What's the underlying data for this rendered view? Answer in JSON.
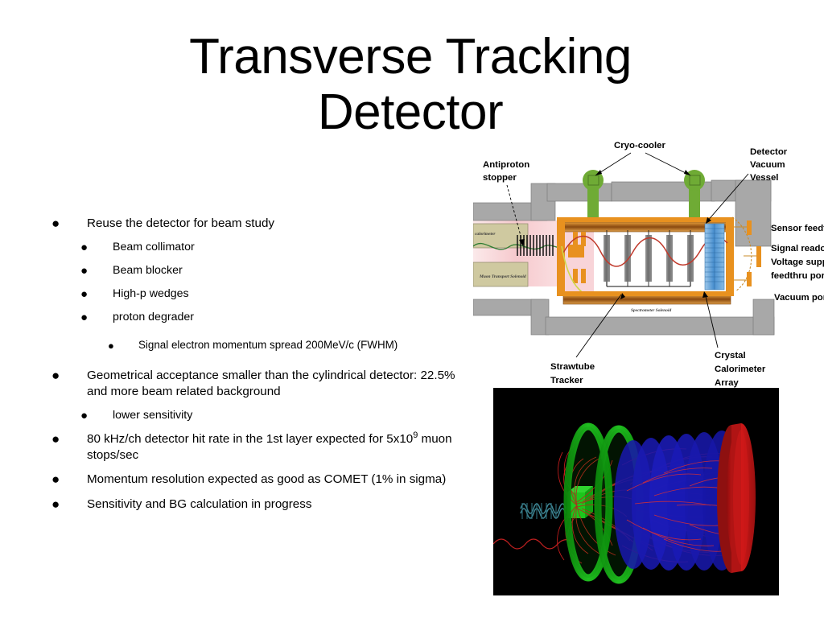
{
  "slide": {
    "title": "Transverse Tracking\nDetector"
  },
  "body": {
    "bullets": [
      {
        "level": 1,
        "text": "Reuse the detector for beam study"
      },
      {
        "level": 2,
        "text": "Beam collimator"
      },
      {
        "level": 2,
        "text": "Beam blocker"
      },
      {
        "level": 2,
        "text": "High-p wedges"
      },
      {
        "level": 2,
        "text": "proton degrader"
      },
      {
        "level": 3,
        "text": "Signal electron momentum spread 200MeV/c (FWHM)"
      },
      {
        "level": 1,
        "text": "Geometrical acceptance smaller than the cylindrical detector: 22.5% and more beam related background"
      },
      {
        "level": 2,
        "text": "lower sensitivity"
      },
      {
        "level": 1,
        "text": "80 kHz/ch detector hit rate in the 1st layer expected for 5x10⁹ muon stops/sec"
      },
      {
        "level": 1,
        "text": "Momentum resolution expected as good as COMET (1% in sigma)"
      },
      {
        "level": 1,
        "text": "Sensitivity and BG calculation in progress"
      }
    ]
  },
  "diagram": {
    "labels": {
      "cryo_cooler": "Cryo-cooler",
      "antiproton_stopper": "Antiproton stopper",
      "antiproton_stopper_line1": "Antiproton",
      "antiproton_stopper_line2": "stopper",
      "detector_vacuum_vessel_line1": "Detector",
      "detector_vacuum_vessel_line2": "Vacuum",
      "detector_vacuum_vessel_line3": "Vessel",
      "sensor_feedthru": "Sensor feedthru",
      "signal_readout_line1": "Signal readout &",
      "signal_readout_line2": "Voltage supply",
      "signal_readout_line3": "feedthru port",
      "vacuum_port": "Vacuum port",
      "strawtube_tracker_line1": "Strawtube",
      "strawtube_tracker_line2": "Tracker",
      "crystal_calorimeter_line1": "Crystal",
      "crystal_calorimeter_line2": "Calorimeter",
      "crystal_calorimeter_line3": "Array",
      "calorimeter_inline": "calorimeter",
      "muon_transport_solenoid": "Muon Transport Solenoid",
      "spectrometer_solenoid": "Spectrometer Solenoid"
    },
    "colors": {
      "steel_gray": "#a8a8a8",
      "steel_gray_dark": "#8e8e8e",
      "cryo_green": "#6fab35",
      "flange_orange": "#e8911f",
      "coil_orange": "#c9741a",
      "crystal_blue": "#5b9bd5",
      "track_red": "#c0392b",
      "beam_pink": "#f7cfd2",
      "khaki": "#cfc9a0"
    }
  },
  "simulation": {
    "colors": {
      "background": "#000000",
      "tracker_ring_green": "#14a014",
      "strawtube_blue": "#1a1ab4",
      "calorimeter_red": "#c81414",
      "track_red": "#d42020",
      "beam_cyan": "#3c7f8c",
      "target_green": "#2ee62e"
    }
  }
}
